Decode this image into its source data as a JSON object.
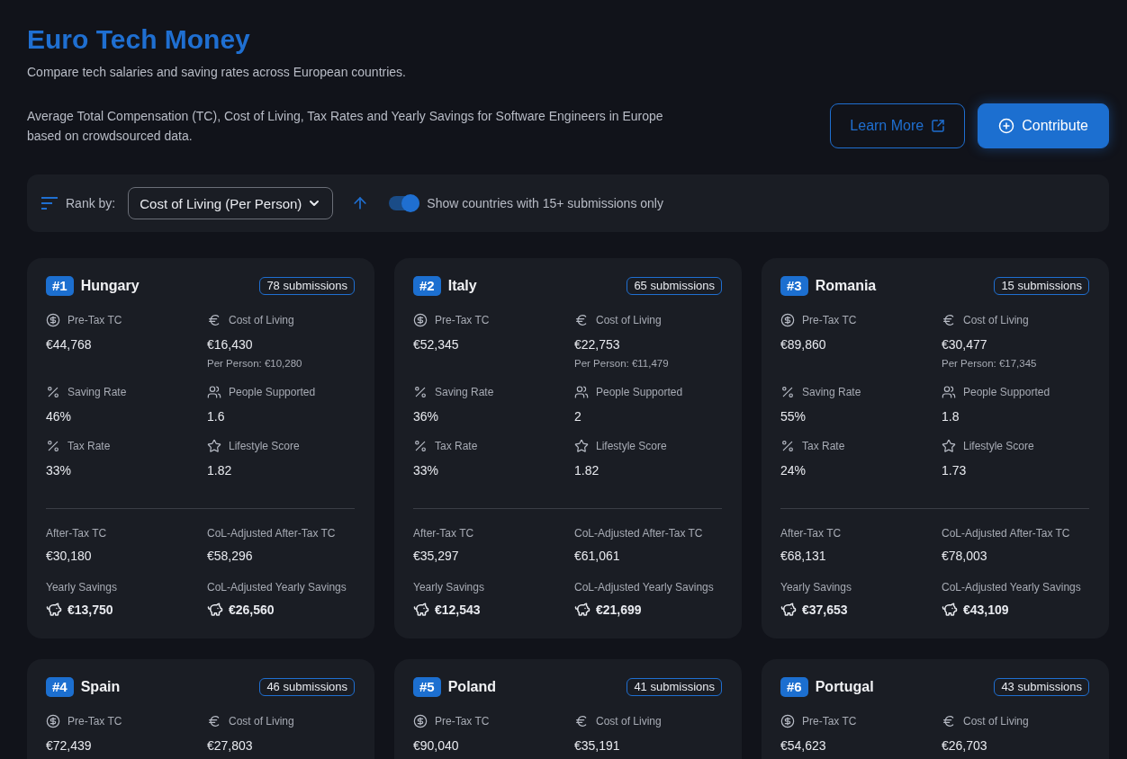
{
  "header": {
    "title": "Euro Tech Money",
    "subtitle": "Compare tech salaries and saving rates across European countries."
  },
  "intro": "Average Total Compensation (TC), Cost of Living, Tax Rates and Yearly Savings for Software Engineers in Europe based on crowdsourced data.",
  "actions": [
    {
      "kind": "outline",
      "label": "Learn More"
    },
    {
      "kind": "primary",
      "label": "Contribute"
    }
  ],
  "toolbar": {
    "rank_label": "Rank by:",
    "rank_value": "Cost of Living (Per Person)",
    "ascending": true,
    "filter": {
      "label": "Show countries with 15+ submissions only",
      "on": true
    }
  },
  "cards": [
    {
      "rank": "#1",
      "country": "Hungary",
      "submissions": "78 submissions",
      "stats": [
        {
          "kind": "dollar",
          "label": "Pre-Tax TC",
          "value": "€44,768"
        },
        {
          "kind": "euro",
          "label": "Cost of Living",
          "value": "€16,430",
          "note": "Per Person: €10,280"
        },
        {
          "kind": "percent",
          "label": "Saving Rate",
          "value": "46%"
        },
        {
          "kind": "people",
          "label": "People Supported",
          "value": "1.6"
        },
        {
          "kind": "percent",
          "label": "Tax Rate",
          "value": "33%"
        },
        {
          "kind": "star",
          "label": "Lifestyle Score",
          "value": "1.82"
        }
      ],
      "totals": [
        {
          "kind": "plain",
          "label": "After-Tax TC",
          "value": "€30,180"
        },
        {
          "kind": "plain",
          "label": "CoL-Adjusted After-Tax TC",
          "value": "€58,296"
        },
        {
          "kind": "savings",
          "label": "Yearly Savings",
          "value": "€13,750"
        },
        {
          "kind": "savings",
          "label": "CoL-Adjusted Yearly Savings",
          "value": "€26,560"
        }
      ]
    },
    {
      "rank": "#2",
      "country": "Italy",
      "submissions": "65 submissions",
      "stats": [
        {
          "kind": "dollar",
          "label": "Pre-Tax TC",
          "value": "€52,345"
        },
        {
          "kind": "euro",
          "label": "Cost of Living",
          "value": "€22,753",
          "note": "Per Person: €11,479"
        },
        {
          "kind": "percent",
          "label": "Saving Rate",
          "value": "36%"
        },
        {
          "kind": "people",
          "label": "People Supported",
          "value": "2"
        },
        {
          "kind": "percent",
          "label": "Tax Rate",
          "value": "33%"
        },
        {
          "kind": "star",
          "label": "Lifestyle Score",
          "value": "1.82"
        }
      ],
      "totals": [
        {
          "kind": "plain",
          "label": "After-Tax TC",
          "value": "€35,297"
        },
        {
          "kind": "plain",
          "label": "CoL-Adjusted After-Tax TC",
          "value": "€61,061"
        },
        {
          "kind": "savings",
          "label": "Yearly Savings",
          "value": "€12,543"
        },
        {
          "kind": "savings",
          "label": "CoL-Adjusted Yearly Savings",
          "value": "€21,699"
        }
      ]
    },
    {
      "rank": "#3",
      "country": "Romania",
      "submissions": "15 submissions",
      "stats": [
        {
          "kind": "dollar",
          "label": "Pre-Tax TC",
          "value": "€89,860"
        },
        {
          "kind": "euro",
          "label": "Cost of Living",
          "value": "€30,477",
          "note": "Per Person: €17,345"
        },
        {
          "kind": "percent",
          "label": "Saving Rate",
          "value": "55%"
        },
        {
          "kind": "people",
          "label": "People Supported",
          "value": "1.8"
        },
        {
          "kind": "percent",
          "label": "Tax Rate",
          "value": "24%"
        },
        {
          "kind": "star",
          "label": "Lifestyle Score",
          "value": "1.73"
        }
      ],
      "totals": [
        {
          "kind": "plain",
          "label": "After-Tax TC",
          "value": "€68,131"
        },
        {
          "kind": "plain",
          "label": "CoL-Adjusted After-Tax TC",
          "value": "€78,003"
        },
        {
          "kind": "savings",
          "label": "Yearly Savings",
          "value": "€37,653"
        },
        {
          "kind": "savings",
          "label": "CoL-Adjusted Yearly Savings",
          "value": "€43,109"
        }
      ]
    },
    {
      "rank": "#4",
      "country": "Spain",
      "submissions": "46 submissions",
      "stats": [
        {
          "kind": "dollar",
          "label": "Pre-Tax TC",
          "value": "€72,439"
        },
        {
          "kind": "euro",
          "label": "Cost of Living",
          "value": "€27,803"
        }
      ]
    },
    {
      "rank": "#5",
      "country": "Poland",
      "submissions": "41 submissions",
      "stats": [
        {
          "kind": "dollar",
          "label": "Pre-Tax TC",
          "value": "€90,040"
        },
        {
          "kind": "euro",
          "label": "Cost of Living",
          "value": "€35,191"
        }
      ]
    },
    {
      "rank": "#6",
      "country": "Portugal",
      "submissions": "43 submissions",
      "stats": [
        {
          "kind": "dollar",
          "label": "Pre-Tax TC",
          "value": "€54,623"
        },
        {
          "kind": "euro",
          "label": "Cost of Living",
          "value": "€26,703"
        }
      ]
    }
  ]
}
